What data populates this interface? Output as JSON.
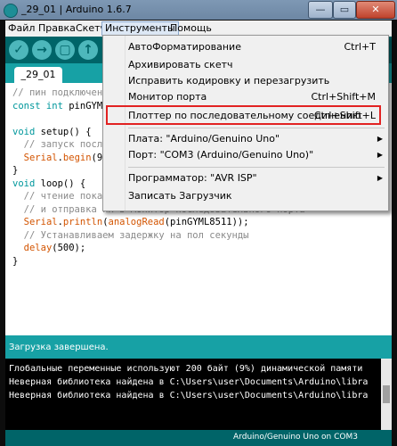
{
  "window": {
    "title": "_29_01 | Arduino 1.6.7",
    "min": "—",
    "max": "▭",
    "close": "✕"
  },
  "menubar": [
    "Файл",
    "Правка",
    "Скетч",
    "Инструменты",
    "Помощь"
  ],
  "toolbar": {
    "verify": "✓",
    "upload": "→",
    "new": "▢",
    "open": "↑",
    "save": "↓"
  },
  "tab": {
    "label": "_29_01"
  },
  "code": {
    "l1": "// пин подключения",
    "l2_kw": "const int",
    "l2": " pinGYML",
    "l3_kw": "void",
    "l3": " setup() {",
    "l4": "  // запуск посл",
    "l5_fn": "Serial",
    "l5_fn2": "begin",
    "l5a": "  ",
    "l5b": ".",
    "l5c": "(9",
    "l6": "}",
    "l7_kw": "void",
    "l7": " loop() {",
    "l8": "  // чтение пока",
    "l9": "  // и отправка их в монитор последовательного порта",
    "l10_fn": "Serial",
    "l10_fn2": "println",
    "l10_fn3": "analogRead",
    "l10a": "  ",
    "l10b": ".",
    "l10c": "(",
    "l10d": "(pinGYML8511));",
    "l11": "  // Устанавливаем задержку на пол секунды",
    "l12_fn": "delay",
    "l12a": "  ",
    "l12b": "(500);",
    "l13": "}"
  },
  "status": {
    "text": "Загрузка завершена."
  },
  "console": {
    "line1": "Глобальные переменные используют 200 байт (9%) динамической памяти",
    "line2": "Неверная библиотека найдена в C:\\Users\\user\\Documents\\Arduino\\libra",
    "line3": "Неверная библиотека найдена в C:\\Users\\user\\Documents\\Arduino\\libra"
  },
  "footer": {
    "board": "Arduino/Genuino Uno on COM3"
  },
  "dropdown": {
    "autoformat": {
      "label": "АвтоФорматирование",
      "shortcut": "Ctrl+T"
    },
    "archive": {
      "label": "Архивировать скетч"
    },
    "fix_encoding": {
      "label": "Исправить кодировку и перезагрузить"
    },
    "serial_monitor": {
      "label": "Монитор порта",
      "shortcut": "Ctrl+Shift+M"
    },
    "serial_plotter": {
      "label": "Плоттер по последовательному соединению",
      "shortcut": "Ctrl+Shift+L"
    },
    "board": {
      "label": "Плата: \"Arduino/Genuino Uno\"",
      "arrow": "▶"
    },
    "port": {
      "label": "Порт: \"COM3 (Arduino/Genuino Uno)\"",
      "arrow": "▶"
    },
    "programmer": {
      "label": "Программатор: \"AVR ISP\"",
      "arrow": "▶"
    },
    "burn_bootloader": {
      "label": "Записать Загрузчик"
    }
  },
  "colors": {
    "accent": "#006468",
    "tab_bar": "#17a1a5",
    "highlight_box": "#e22222"
  }
}
